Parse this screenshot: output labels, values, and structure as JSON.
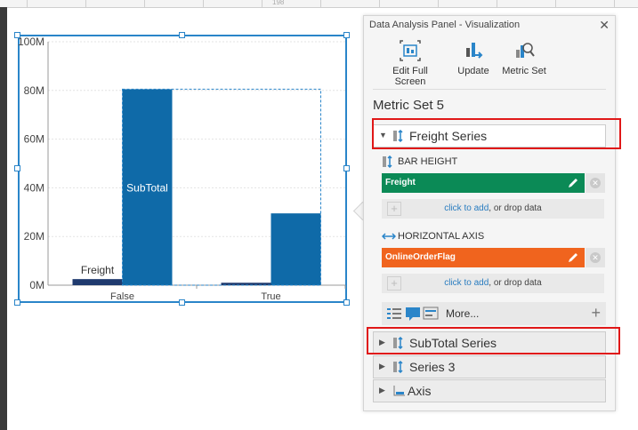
{
  "ruler": {
    "mark": "198"
  },
  "chart_data": {
    "type": "bar",
    "categories": [
      "False",
      "True"
    ],
    "series": [
      {
        "name": "Freight",
        "values": [
          2.5,
          1.0
        ],
        "color": "#1f3a6e"
      },
      {
        "name": "SubTotal",
        "values": [
          80.5,
          29.5
        ],
        "color": "#0f6aa8"
      }
    ],
    "bar_labels": [
      "Freight",
      "SubTotal"
    ],
    "yticks": [
      "0M",
      "20M",
      "40M",
      "60M",
      "80M",
      "100M"
    ],
    "ylim": [
      0,
      100
    ],
    "grid": true
  },
  "panel": {
    "title": "Data Analysis Panel - Visualization",
    "close": "✕",
    "toolbar": [
      {
        "label": "Edit Full Screen",
        "icon": "full-screen-icon"
      },
      {
        "label": "Update",
        "icon": "update-icon"
      },
      {
        "label": "Metric Set",
        "icon": "metric-set-icon"
      }
    ],
    "metric_set_title": "Metric Set 5",
    "freight_series": {
      "label": "Freight Series",
      "arrow": "▼",
      "bar_height_label": "BAR HEIGHT",
      "bar_height_field": "Freight",
      "bar_height_color": "#0b8a56",
      "horizontal_axis_label": "HORIZONTAL AXIS",
      "horizontal_axis_field": "OnlineOrderFlag",
      "horizontal_axis_color": "#f0641e",
      "add_link": "click to add",
      "add_rest": ", or drop data"
    },
    "more": {
      "label": "More...",
      "plus": "+"
    },
    "other_series": [
      {
        "label": "SubTotal Series",
        "arrow": "▶"
      },
      {
        "label": "Series 3",
        "arrow": "▶"
      },
      {
        "label": "Axis",
        "arrow": "▶"
      }
    ],
    "highlight_color": "#e01818"
  }
}
